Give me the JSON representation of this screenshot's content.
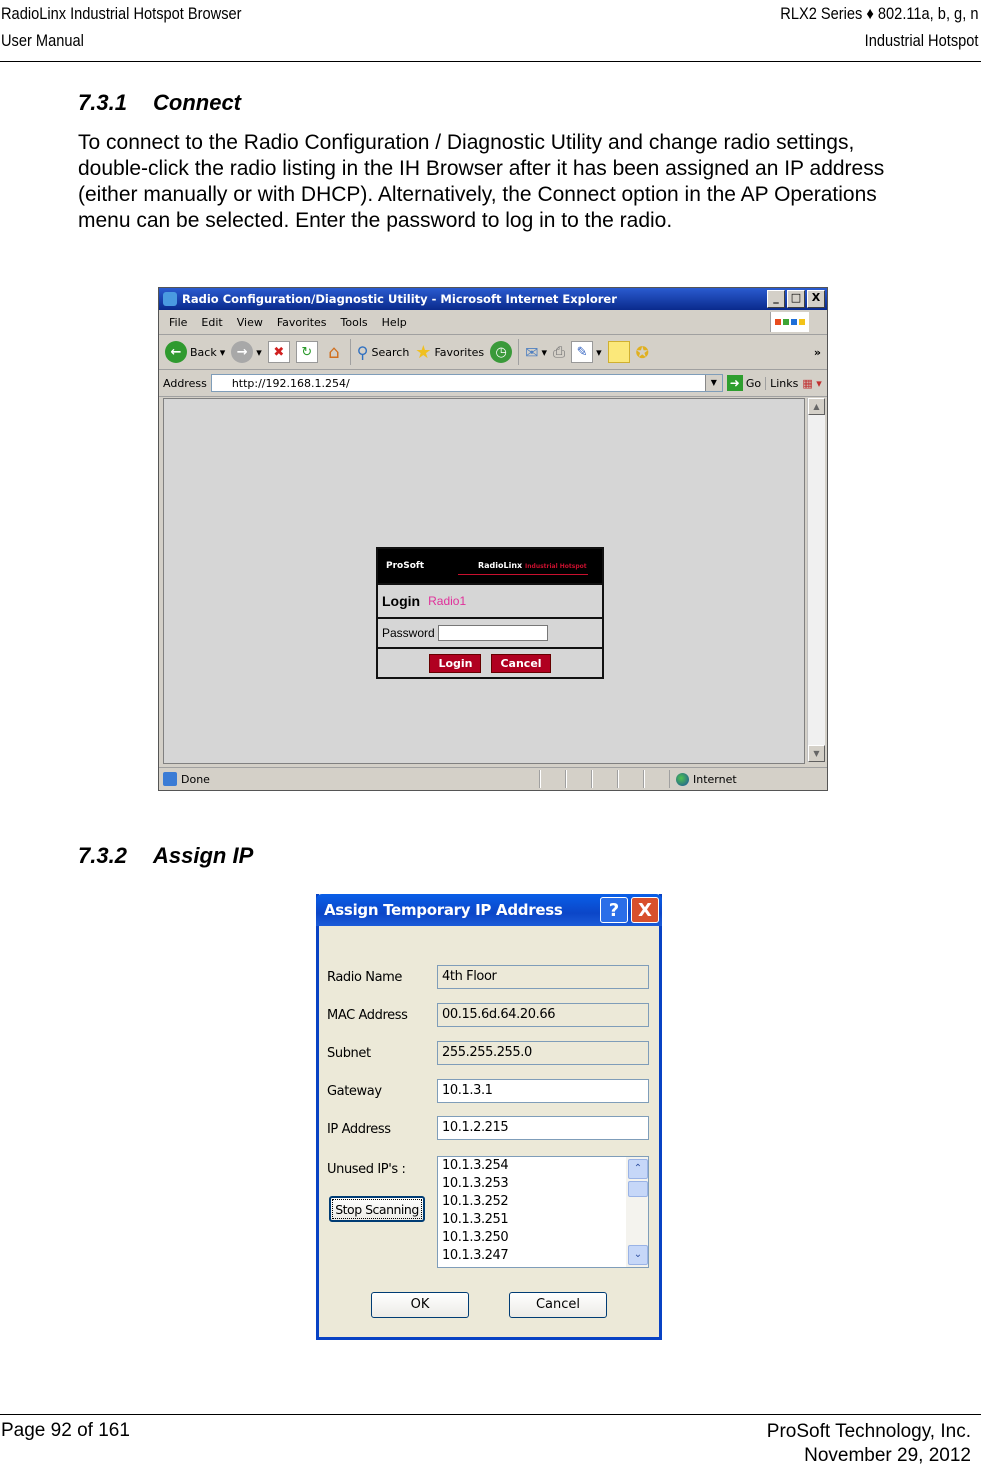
{
  "header": {
    "left_line1": "RadioLinx Industrial Hotspot Browser",
    "left_line2": "User Manual",
    "right_line1": "RLX2 Series ♦ 802.11a, b, g, n",
    "right_line2": "Industrial Hotspot"
  },
  "section1": {
    "number": "7.3.1",
    "title": "Connect",
    "paragraph": "To connect to the Radio Configuration / Diagnostic Utility and change radio settings, double-click the radio listing in the IH Browser after it has been assigned an IP address (either manually or with DHCP). Alternatively, the Connect option in the AP Operations menu can be selected. Enter the password to log in to the radio."
  },
  "browser": {
    "title": "Radio Configuration/Diagnostic Utility - Microsoft Internet Explorer",
    "window_buttons": {
      "minimize": "_",
      "maximize": "□",
      "close": "X"
    },
    "menu": [
      "File",
      "Edit",
      "View",
      "Favorites",
      "Tools",
      "Help"
    ],
    "toolbar": {
      "back": "Back",
      "search": "Search",
      "favorites": "Favorites",
      "more": "»"
    },
    "address_label": "Address",
    "address_value": "http://192.168.1.254/",
    "go_label": "Go",
    "links_label": "Links",
    "status_text": "Done",
    "zone_text": "Internet",
    "login_panel": {
      "brand_left": "ProSoft",
      "brand_right": "RadioLinx",
      "brand_tag": "Industrial Hotspot",
      "login_title": "Login",
      "radio_name": "Radio1",
      "password_label": "Password",
      "password_value": "",
      "login_button": "Login",
      "cancel_button": "Cancel"
    }
  },
  "section2": {
    "number": "7.3.2",
    "title": "Assign IP"
  },
  "dialog": {
    "title": "Assign Temporary IP Address",
    "help_button": "?",
    "close_button": "X",
    "fields": [
      {
        "label": "Radio Name",
        "value": "4th Floor",
        "editable": false
      },
      {
        "label": "MAC Address",
        "value": "00.15.6d.64.20.66",
        "editable": false
      },
      {
        "label": "Subnet",
        "value": "255.255.255.0",
        "editable": false
      },
      {
        "label": "Gateway",
        "value": "10.1.3.1",
        "editable": true
      },
      {
        "label": "IP Address",
        "value": "10.1.2.215",
        "editable": true
      }
    ],
    "unused_label": "Unused IP's :",
    "unused_ips": [
      "10.1.3.254",
      "10.1.3.253",
      "10.1.3.252",
      "10.1.3.251",
      "10.1.3.250",
      "10.1.3.247"
    ],
    "stop_button": "Stop Scanning",
    "ok_button": "OK",
    "cancel_button": "Cancel"
  },
  "footer": {
    "page": "Page 92 of 161",
    "company": "ProSoft Technology, Inc.",
    "date": "November 29, 2012"
  }
}
